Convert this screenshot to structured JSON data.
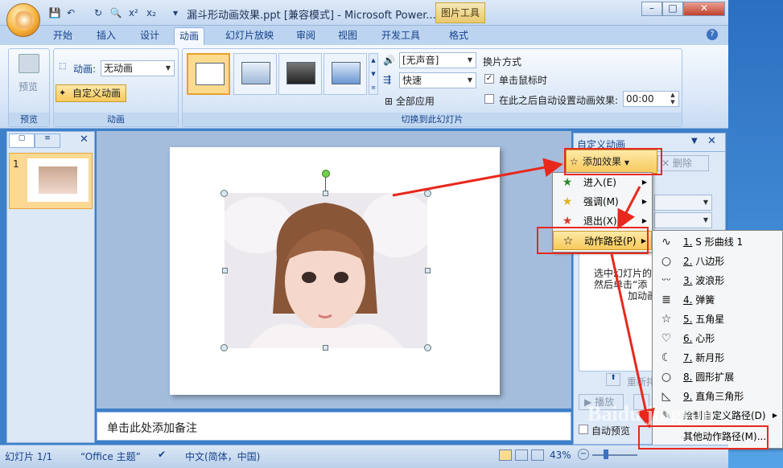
{
  "window": {
    "title": "漏斗形动画效果.ppt [兼容模式] - Microsoft Power...",
    "context_tab": "图片工具"
  },
  "tabs": [
    "开始",
    "插入",
    "设计",
    "动画",
    "幻灯片放映",
    "审阅",
    "视图",
    "开发工具",
    "格式"
  ],
  "ribbon": {
    "preview": {
      "label": "预览",
      "group": "预览"
    },
    "animation": {
      "label": "动画:",
      "value": "无动画",
      "custom": "自定义动画",
      "group": "动画"
    },
    "transition": {
      "sound": "[无声音]",
      "speed": "快速",
      "apply_all": "全部应用",
      "group": "切换到此幻灯片"
    },
    "advance": {
      "title": "换片方式",
      "on_click": "单击鼠标时",
      "auto_after": "在此之后自动设置动画效果:",
      "time": "00:00"
    }
  },
  "slides_pane": {
    "slide_number": "1"
  },
  "notes": {
    "placeholder": "单击此处添加备注"
  },
  "task_pane": {
    "title": "自定义动画",
    "add_effect": "添加效果",
    "remove": "删除",
    "hint_line1": "选中幻灯片的",
    "hint_line2": "然后单击“添",
    "hint_line3": "加动画",
    "reorder": "重新排",
    "play": "播放",
    "autopreview": "自动预览"
  },
  "effect_menu": [
    {
      "label": "进入(E)",
      "icon": "star-green"
    },
    {
      "label": "强调(M)",
      "icon": "star-yellow"
    },
    {
      "label": "退出(X)",
      "icon": "star-red"
    },
    {
      "label": "动作路径(P)",
      "icon": "star-outline"
    }
  ],
  "path_menu": [
    {
      "num": "1.",
      "label": "S 形曲线 1",
      "icon": "s-curve-icon",
      "glyph": "∿"
    },
    {
      "num": "2.",
      "label": "八边形",
      "icon": "octagon-icon",
      "glyph": "○"
    },
    {
      "num": "3.",
      "label": "波浪形",
      "icon": "wave-icon",
      "glyph": "ᵕᵕ"
    },
    {
      "num": "4.",
      "label": "弹簧",
      "icon": "spring-icon",
      "glyph": "≣"
    },
    {
      "num": "5.",
      "label": "五角星",
      "icon": "star-icon",
      "glyph": "☆"
    },
    {
      "num": "6.",
      "label": "心形",
      "icon": "heart-icon",
      "glyph": "♡"
    },
    {
      "num": "7.",
      "label": "新月形",
      "icon": "crescent-icon",
      "glyph": "☾"
    },
    {
      "num": "8.",
      "label": "圆形扩展",
      "icon": "circle-icon",
      "glyph": "○"
    },
    {
      "num": "9.",
      "label": "直角三角形",
      "icon": "triangle-icon",
      "glyph": "◺"
    },
    {
      "num": "",
      "label": "绘制自定义路径(D)",
      "icon": "draw-path-icon",
      "glyph": ""
    },
    {
      "num": "",
      "label": "其他动作路径(M)...",
      "icon": "more-icon",
      "glyph": ""
    }
  ],
  "status": {
    "slide": "幻灯片 1/1",
    "theme": "“Office 主题”",
    "language": "中文(简体，中国)",
    "zoom": "43%"
  },
  "watermark": "Baidu jingyan",
  "colors": {
    "accent_red": "#e8281d",
    "ribbon_blue": "#15428b"
  }
}
